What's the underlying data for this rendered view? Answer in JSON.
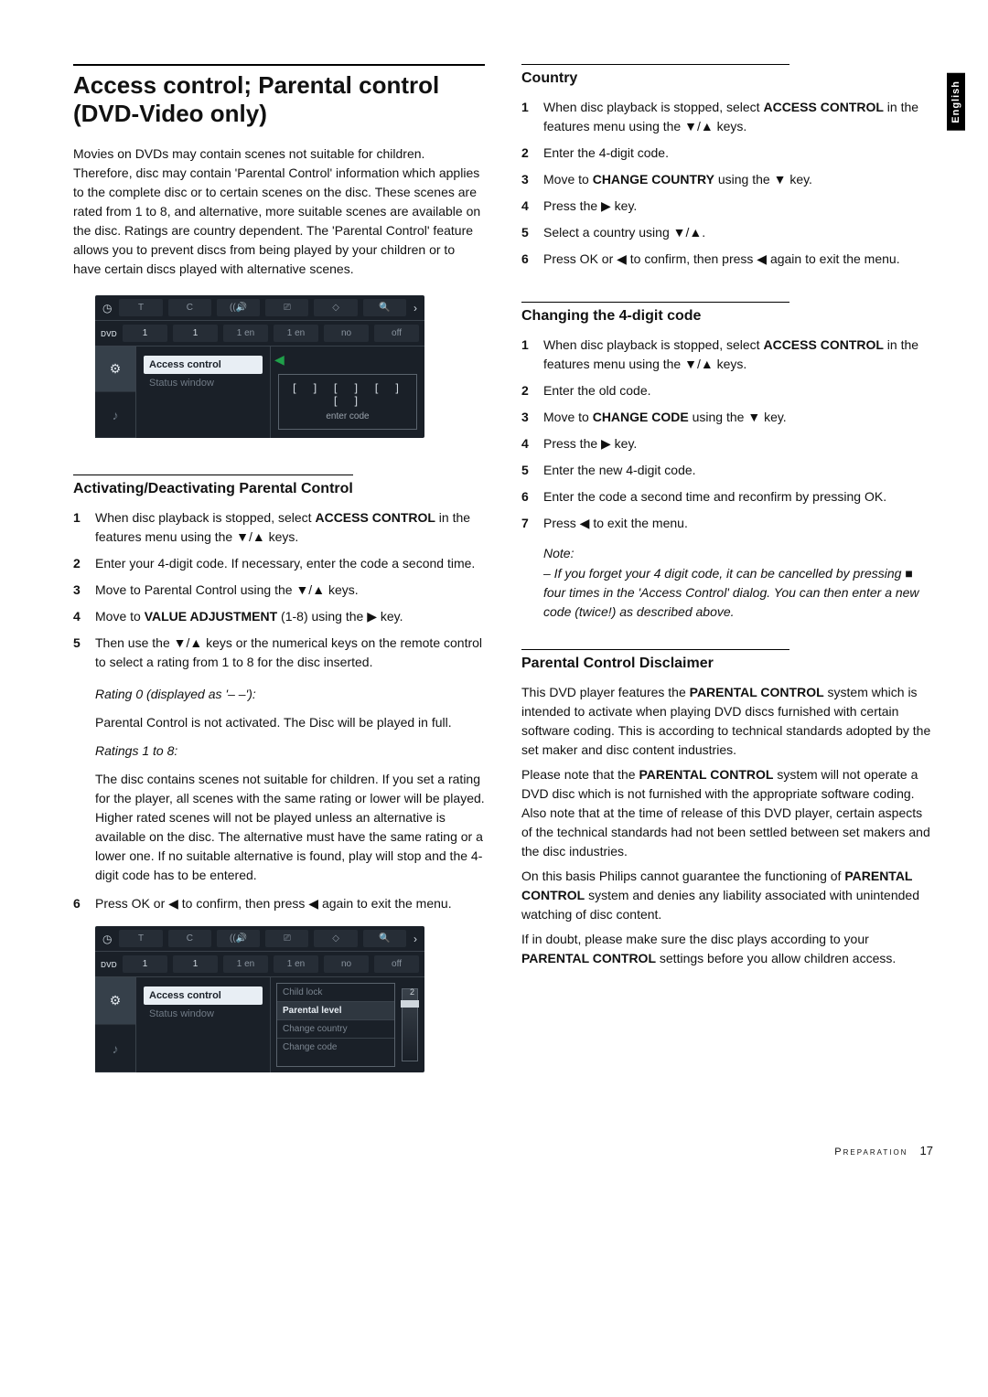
{
  "side_tab": "English",
  "left": {
    "title": "Access control; Parental control (DVD-Video only)",
    "intro": "Movies on DVDs may contain scenes not suitable for children. Therefore, disc may contain 'Parental Control' information which applies to the complete disc or to certain scenes on the disc. These scenes are rated from 1 to 8, and alternative, more suitable scenes are available on the disc. Ratings are country dependent. The 'Parental Control' feature allows you to prevent discs from being played by your children or to have certain discs played with alternative scenes.",
    "osd1": {
      "top": [
        "1",
        "1",
        "1 en",
        "1 en",
        "no",
        "off"
      ],
      "mid_sel": "Access control",
      "mid_dim": "Status window",
      "enter_slots": "[ ] [ ] [ ] [ ]",
      "enter_lbl": "enter code"
    },
    "sub_activate": "Activating/Deactivating Parental Control",
    "s1": {
      "n": "1",
      "t_a": "When disc playback is stopped, select ",
      "t_b": "ACCESS CONTROL",
      "t_c": " in the features menu using the ▼/▲ keys."
    },
    "s2": {
      "n": "2",
      "t": "Enter your 4-digit code. If necessary, enter the code a second time."
    },
    "s3": {
      "n": "3",
      "t": "Move to Parental Control using the ▼/▲ keys."
    },
    "s4": {
      "n": "4",
      "t_a": "Move to ",
      "t_b": "VALUE ADJUSTMENT",
      "t_c": " (1-8) using the ▶ key."
    },
    "s5": {
      "n": "5",
      "t": "Then use the ▼/▲ keys or the numerical keys on the remote control to select a rating from 1 to 8 for the disc inserted."
    },
    "r0_h": "Rating 0 (displayed as '– –'):",
    "r0_b": "Parental Control is not activated. The Disc will be played in full.",
    "r18_h": "Ratings 1 to 8:",
    "r18_b": "The disc contains scenes not suitable for children. If you set a rating for the player, all scenes with the same rating or lower will be played. Higher rated scenes will not be played unless an alternative is available on the disc. The alternative must have the same rating or a lower one. If no suitable alternative is found, play will stop and the 4-digit code has to be entered.",
    "s6": {
      "n": "6",
      "t": "Press OK or ◀ to confirm, then press ◀ again to exit the menu."
    },
    "osd2": {
      "top": [
        "1",
        "1",
        "1 en",
        "1 en",
        "no",
        "off"
      ],
      "mid_sel": "Access control",
      "mid_dim": "Status window",
      "menu": [
        "Child lock",
        "Parental level",
        "Change country",
        "Change code"
      ],
      "slider_num": "2"
    }
  },
  "right": {
    "sub_country": "Country",
    "c1": {
      "n": "1",
      "t_a": "When disc playback is stopped, select ",
      "t_b": "ACCESS CONTROL",
      "t_c": " in the features menu using the ▼/▲ keys."
    },
    "c2": {
      "n": "2",
      "t": "Enter the 4-digit code."
    },
    "c3": {
      "n": "3",
      "t_a": "Move to ",
      "t_b": "CHANGE COUNTRY",
      "t_c": " using the ▼ key."
    },
    "c4": {
      "n": "4",
      "t": "Press the ▶ key."
    },
    "c5": {
      "n": "5",
      "t": "Select a country using ▼/▲."
    },
    "c6": {
      "n": "6",
      "t": "Press OK or ◀ to confirm, then press ◀ again to exit the menu."
    },
    "sub_change": "Changing the 4-digit code",
    "g1": {
      "n": "1",
      "t_a": "When disc playback is stopped, select ",
      "t_b": "ACCESS CONTROL",
      "t_c": " in the features menu using the ▼/▲ keys."
    },
    "g2": {
      "n": "2",
      "t": "Enter the old code."
    },
    "g3": {
      "n": "3",
      "t_a": "Move to ",
      "t_b": "CHANGE CODE",
      "t_c": " using the ▼ key."
    },
    "g4": {
      "n": "4",
      "t": "Press the ▶ key."
    },
    "g5": {
      "n": "5",
      "t": "Enter the new 4-digit code."
    },
    "g6": {
      "n": "6",
      "t": "Enter the code a second time and reconfirm by pressing OK."
    },
    "g7": {
      "n": "7",
      "t": "Press ◀ to exit the menu."
    },
    "note_lbl": "Note:",
    "note_body": "– If you forget your 4 digit code, it can be cancelled by pressing ■ four times in the 'Access Control' dialog. You can then enter a new code (twice!) as described above.",
    "sub_disc": "Parental Control Disclaimer",
    "d1_a": "This DVD player features the ",
    "d1_b": "PARENTAL CONTROL",
    "d1_c": " system which is intended to activate when playing DVD discs furnished with certain software coding. This is according to technical standards adopted by the set maker and disc content industries.",
    "d2_a": "Please note that the ",
    "d2_b": "PARENTAL CONTROL",
    "d2_c": " system will not operate a DVD disc which is not furnished with the appropriate software coding. Also note that at the time of release of this DVD player, certain aspects of the technical standards had not been settled between set makers and the disc industries.",
    "d3_a": "On this basis Philips cannot guarantee the functioning of ",
    "d3_b": "PARENTAL CONTROL",
    "d3_c": " system and denies any liability associated with unintended watching of disc content.",
    "d4_a": "If in doubt, please make sure the disc plays according to your ",
    "d4_b": "PARENTAL CONTROL",
    "d4_c": " settings before you allow children access."
  },
  "footer": {
    "label": "Preparation",
    "page": "17"
  }
}
